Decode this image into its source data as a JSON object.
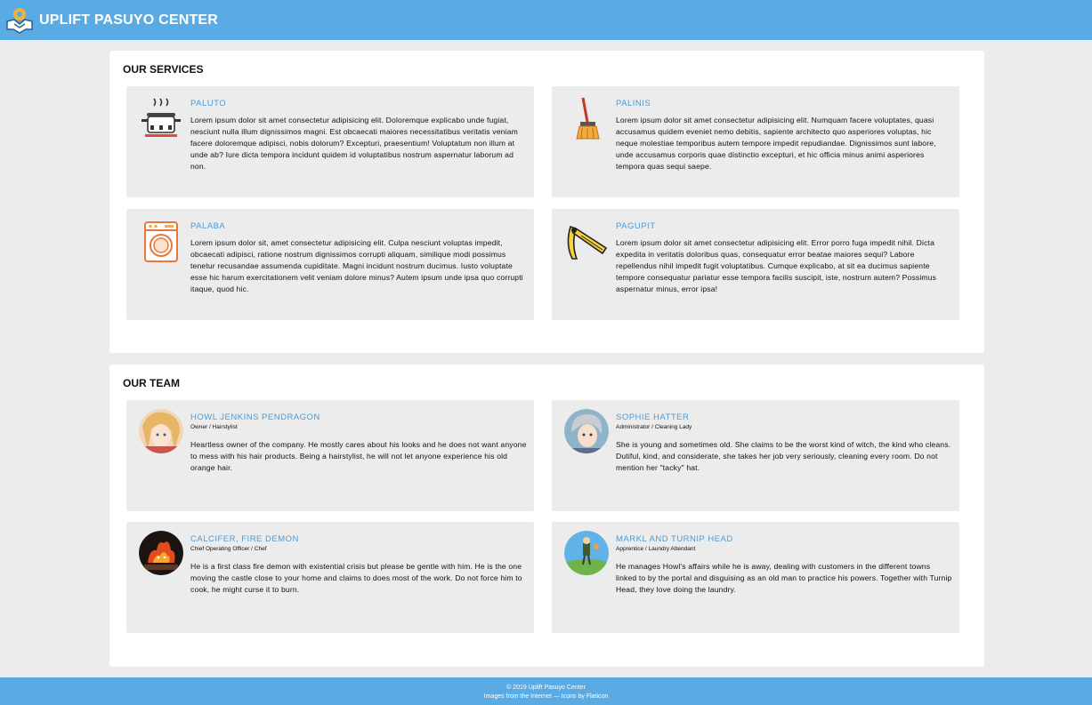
{
  "header": {
    "brand": "UPLIFT PASUYO CENTER",
    "logo_icon": "handshake-cog-icon"
  },
  "services": {
    "title": "OUR SERVICES",
    "items": [
      {
        "title": "PALUTO",
        "icon": "cooking-pot-icon",
        "description": "Lorem ipsum dolor sit amet consectetur adipisicing elit. Doloremque explicabo unde fugiat, nesciunt nulla illum dignissimos magni. Est obcaecati maiores necessitatibus veritatis veniam facere doloremque adipisci, nobis dolorum? Excepturi, praesentium! Voluptatum non illum at unde ab? Iure dicta tempora incidunt quidem id voluptatibus nostrum aspernatur laborum ad non."
      },
      {
        "title": "PALINIS",
        "icon": "broom-icon",
        "description": "Lorem ipsum dolor sit amet consectetur adipisicing elit. Numquam facere voluptates, quasi accusamus quidem eveniet nemo debitis, sapiente architecto quo asperiores voluptas, hic neque molestiae temporibus autem tempore impedit repudiandae. Dignissimos sunt labore, unde accusamus corporis quae distinctio excepturi, et hic officia minus animi asperiores tempora quas sequi saepe."
      },
      {
        "title": "PALABA",
        "icon": "washing-machine-icon",
        "description": "Lorem ipsum dolor sit, amet consectetur adipisicing elit. Culpa nesciunt voluptas impedit, obcaecati adipisci, ratione nostrum dignissimos corrupti aliquam, similique modi possimus tenetur recusandae assumenda cupiditate. Magni incidunt nostrum ducimus. Iusto voluptate esse hic harum exercitationem velit veniam dolore minus? Autem ipsum unde ipsa quo corrupti itaque, quod hic."
      },
      {
        "title": "PAGUPIT",
        "icon": "razor-icon",
        "description": "Lorem ipsum dolor sit amet consectetur adipisicing elit. Error porro fuga impedit nihil. Dicta expedita in veritatis doloribus quas, consequatur error beatae maiores sequi? Labore repellendus nihil impedit fugit voluptatibus. Cumque explicabo, at sit ea ducimus sapiente tempore consequatur pariatur esse tempora facilis suscipit, iste, nostrum autem? Possimus aspernatur minus, error ipsa!"
      }
    ]
  },
  "team": {
    "title": "OUR TEAM",
    "members": [
      {
        "name": "HOWL JENKINS PENDRAGON",
        "role": "Owner / Hairstylist",
        "avatar": "howl-avatar",
        "bio": "Heartless owner of the company. He mostly cares about his looks and he does not want anyone to mess with his hair products. Being a hairstylist, he will not let anyone experience his old orange hair."
      },
      {
        "name": "SOPHIE HATTER",
        "role": "Administrator / Cleaning Lady",
        "avatar": "sophie-avatar",
        "bio": "She is young and sometimes old. She claims to be the worst kind of witch, the kind who cleans. Dutiful, kind, and considerate, she takes her job very seriously, cleaning every room. Do not mention her \"tacky\" hat."
      },
      {
        "name": "CALCIFER, FIRE DEMON",
        "role": "Chief Operating Officer / Chef",
        "avatar": "calcifer-avatar",
        "bio": "He is a first class fire demon with existential crisis but please be gentle with him. He is the one moving the castle close to your home and claims to does most of the work. Do not force him to cook, he might curse it to burn."
      },
      {
        "name": "MARKL AND TURNIP HEAD",
        "role": "Apprentice / Laundry Attendant",
        "avatar": "markl-avatar",
        "bio": "He manages Howl's affairs while he is away, dealing with customers in the different towns linked to by the portal and disguising as an old man to practice his powers. Together with Turnip Head, they love doing the laundry."
      }
    ]
  },
  "footer": {
    "copyright": "© 2019 Uplift Pasuyo Center",
    "credits": "Images from the Internet — Icons by Flaticon"
  },
  "colors": {
    "accent": "#5aaae3",
    "title_blue": "#4a9bd6",
    "card_bg": "#ececec"
  }
}
